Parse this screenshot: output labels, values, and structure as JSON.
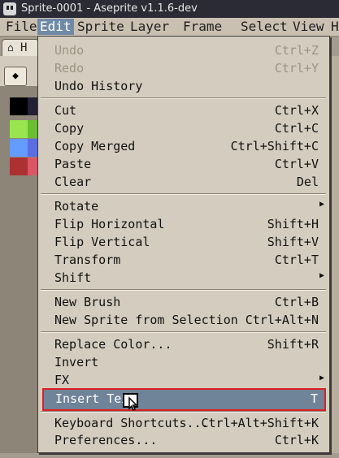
{
  "window": {
    "title": "Sprite-0001 - Aseprite v1.1.6-dev"
  },
  "menubar": [
    {
      "label": "File"
    },
    {
      "label": "Edit",
      "active": true
    },
    {
      "label": "Sprite"
    },
    {
      "label": "Layer"
    },
    {
      "label": "Frame"
    },
    {
      "label": "Select"
    },
    {
      "label": "View"
    },
    {
      "label": "H"
    }
  ],
  "tabs": {
    "home_label": "H"
  },
  "palette": [
    "#000000",
    "#222034",
    "#99e550",
    "#6abe30",
    "#639bff",
    "#5b6ee1",
    "#ac3232",
    "#d95763"
  ],
  "edit_menu": {
    "undo": {
      "label": "Undo",
      "shortcut": "Ctrl+Z"
    },
    "redo": {
      "label": "Redo",
      "shortcut": "Ctrl+Y"
    },
    "undo_history": {
      "label": "Undo History"
    },
    "cut": {
      "label": "Cut",
      "shortcut": "Ctrl+X"
    },
    "copy": {
      "label": "Copy",
      "shortcut": "Ctrl+C"
    },
    "copy_merged": {
      "label": "Copy Merged",
      "shortcut": "Ctrl+Shift+C"
    },
    "paste": {
      "label": "Paste",
      "shortcut": "Ctrl+V"
    },
    "clear": {
      "label": "Clear",
      "shortcut": "Del"
    },
    "rotate": {
      "label": "Rotate"
    },
    "flip_horizontal": {
      "label": "Flip Horizontal",
      "shortcut": "Shift+H"
    },
    "flip_vertical": {
      "label": "Flip Vertical",
      "shortcut": "Shift+V"
    },
    "transform": {
      "label": "Transform",
      "shortcut": "Ctrl+T"
    },
    "shift": {
      "label": "Shift"
    },
    "new_brush": {
      "label": "New Brush",
      "shortcut": "Ctrl+B"
    },
    "new_sprite_from_selection": {
      "label": "New Sprite from Selection",
      "shortcut": "Ctrl+Alt+N"
    },
    "replace_color": {
      "label": "Replace Color...",
      "shortcut": "Shift+R"
    },
    "invert": {
      "label": "Invert"
    },
    "fx": {
      "label": "FX"
    },
    "insert_text": {
      "label": "Insert Text",
      "shortcut": "T"
    },
    "keyboard_shortcuts": {
      "label": "Keyboard Shortcuts...",
      "shortcut": "Ctrl+Alt+Shift+K"
    },
    "preferences": {
      "label": "Preferences...",
      "shortcut": "Ctrl+K"
    }
  },
  "colors": {
    "highlight": "#6f8399",
    "highlight_border": "#e11e1e",
    "menu_bg": "#d4cdbf",
    "menubar_active": "#6f8aa6"
  },
  "icons": {
    "app": "aseprite-logo-icon",
    "home": "house-icon",
    "tool": "eraser-icon",
    "cursor": "mouse-pointer-icon"
  }
}
